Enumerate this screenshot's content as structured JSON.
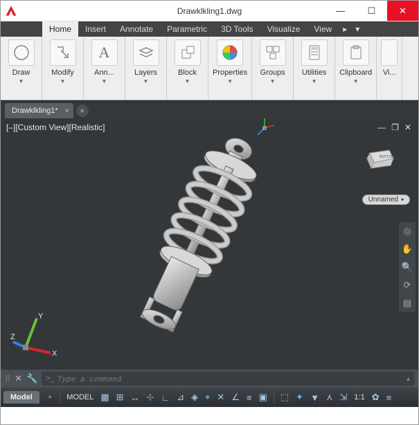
{
  "window": {
    "title": "Drawklkling1.dwg"
  },
  "menu": {
    "tabs": [
      "Home",
      "Insert",
      "Annotate",
      "Parametric",
      "3D Tools",
      "Visualize",
      "View"
    ]
  },
  "ribbon": {
    "panels": [
      {
        "label": "Draw",
        "icon": "circle"
      },
      {
        "label": "Modify",
        "icon": "move"
      },
      {
        "label": "Ann...",
        "icon": "text"
      },
      {
        "label": "Layers",
        "icon": "layers"
      },
      {
        "label": "Block",
        "icon": "block"
      },
      {
        "label": "Properties",
        "icon": "color-wheel"
      },
      {
        "label": "Groups",
        "icon": "groups"
      },
      {
        "label": "Utilities",
        "icon": "calc"
      },
      {
        "label": "Clipboard",
        "icon": "clipboard"
      },
      {
        "label": "Vi...",
        "icon": "more"
      }
    ]
  },
  "doc_tab": {
    "label": "Drawklkling1*"
  },
  "viewport": {
    "label": "[–][Custom View][Realistic]",
    "cube_face": "BOTTOM",
    "badge": "Unnamed",
    "ucs": {
      "x": "X",
      "y": "Y",
      "z": "Z"
    }
  },
  "command": {
    "prompt": ">_",
    "placeholder": "Type a command"
  },
  "status": {
    "model_tab": "Model",
    "model_btn": "MODEL",
    "scale": "1:1"
  }
}
